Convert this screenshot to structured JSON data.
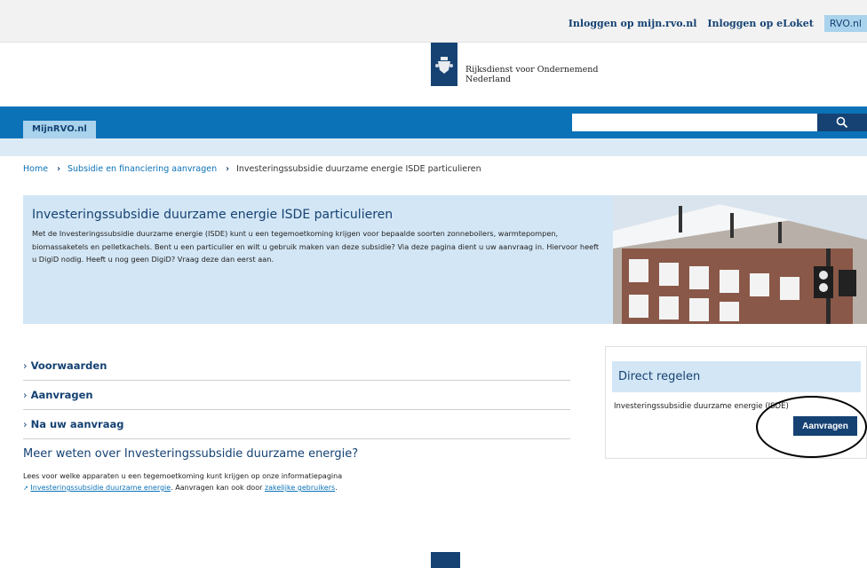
{
  "topbar": {
    "links": [
      "Inloggen op mijn.rvo.nl",
      "Inloggen op eLoket"
    ],
    "rvo_tab": "RVO.nl"
  },
  "header": {
    "logo_text_line1": "Rijksdienst voor Ondernemend",
    "logo_text_line2": "Nederland"
  },
  "nav": {
    "tab_label": "MijnRVO.nl",
    "search_placeholder": ""
  },
  "breadcrumb": {
    "items": [
      "Home",
      "Subsidie en financiering aanvragen",
      "Investeringssubsidie duurzame energie ISDE particulieren"
    ]
  },
  "hero": {
    "title": "Investeringssubsidie duurzame energie ISDE particulieren",
    "text": "Met de Investeringssubsidie duurzame energie (ISDE) kunt u een tegemoetkoming krijgen voor bepaalde soorten zonneboilers, warmtepompen, biomassaketels en pelletkachels. Bent u een particulier en wilt u gebruik maken van deze subsidie? Via deze pagina dient u uw aanvraag in. Hiervoor heeft u DigiD nodig. Heeft u nog geen DigiD? Vraag deze dan eerst aan."
  },
  "sections": [
    "Voorwaarden",
    "Aanvragen",
    "Na uw aanvraag"
  ],
  "meer": {
    "title": "Meer weten over Investeringssubsidie duurzame energie?",
    "text_before": "Lees voor welke apparaten u een tegemoetkoming kunt krijgen op onze informatiepagina",
    "link1": "Investeringssubsidie duurzame energie",
    "text_middle": ". Aanvragen kan ook door ",
    "link2": "zakelijke gebruikers",
    "text_after": "."
  },
  "side": {
    "title": "Direct regelen",
    "item": "Investeringssubsidie duurzame energie (ISDE)",
    "button": "Aanvragen"
  },
  "colors": {
    "brand_dark": "#154273",
    "brand_blue": "#0b72b8",
    "light_blue": "#d3e6f5"
  }
}
